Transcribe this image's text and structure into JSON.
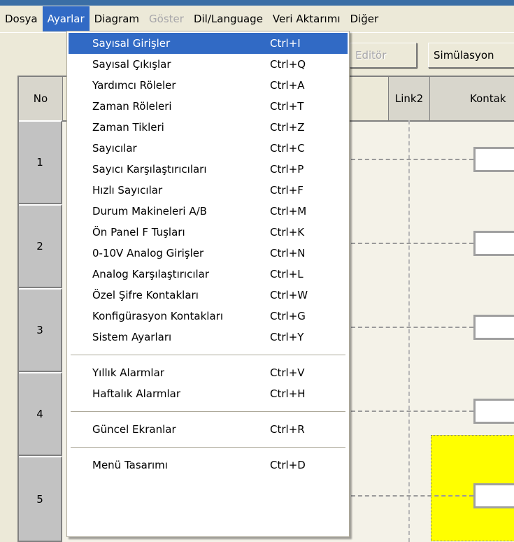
{
  "menubar": {
    "items": [
      {
        "label": "Dosya",
        "state": "normal"
      },
      {
        "label": "Ayarlar",
        "state": "active"
      },
      {
        "label": "Diagram",
        "state": "normal"
      },
      {
        "label": "Göster",
        "state": "disabled"
      },
      {
        "label": "Dil/Language",
        "state": "normal"
      },
      {
        "label": "Veri Aktarımı",
        "state": "normal"
      },
      {
        "label": "Diğer",
        "state": "normal"
      }
    ]
  },
  "toolbar": {
    "editor_label": "Editör",
    "simulation_label": "Simülasyon"
  },
  "grid": {
    "headers": {
      "no": "No",
      "link2": "Link2",
      "kontak": "Kontak"
    },
    "rows": [
      "1",
      "2",
      "3",
      "4",
      "5"
    ]
  },
  "dropdown": {
    "groups": [
      [
        {
          "label": "Sayısal Girişler",
          "shortcut": "Ctrl+I",
          "highlighted": true
        },
        {
          "label": "Sayısal Çıkışlar",
          "shortcut": "Ctrl+Q"
        },
        {
          "label": "Yardımcı Röleler",
          "shortcut": "Ctrl+A"
        },
        {
          "label": "Zaman Röleleri",
          "shortcut": "Ctrl+T"
        },
        {
          "label": "Zaman Tikleri",
          "shortcut": "Ctrl+Z"
        },
        {
          "label": "Sayıcılar",
          "shortcut": "Ctrl+C"
        },
        {
          "label": "Sayıcı Karşılaştırıcıları",
          "shortcut": "Ctrl+P"
        },
        {
          "label": "Hızlı Sayıcılar",
          "shortcut": "Ctrl+F"
        },
        {
          "label": "Durum Makineleri A/B",
          "shortcut": "Ctrl+M"
        },
        {
          "label": "Ön Panel F Tuşları",
          "shortcut": "Ctrl+K"
        },
        {
          "label": "0-10V Analog Girişler",
          "shortcut": "Ctrl+N"
        },
        {
          "label": "Analog Karşılaştırıcılar",
          "shortcut": "Ctrl+L"
        },
        {
          "label": "Özel Şifre Kontakları",
          "shortcut": "Ctrl+W"
        },
        {
          "label": "Konfigürasyon Kontakları",
          "shortcut": "Ctrl+G"
        },
        {
          "label": "Sistem Ayarları",
          "shortcut": "Ctrl+Y"
        }
      ],
      [
        {
          "label": "Yıllık Alarmlar",
          "shortcut": "Ctrl+V"
        },
        {
          "label": "Haftalık Alarmlar",
          "shortcut": "Ctrl+H"
        }
      ],
      [
        {
          "label": "Güncel Ekranlar",
          "shortcut": "Ctrl+R"
        }
      ],
      [
        {
          "label": "Menü Tasarımı",
          "shortcut": "Ctrl+D"
        }
      ]
    ]
  },
  "colors": {
    "highlight": "#316AC5",
    "face": "#ECE9D8",
    "yellow_block": "#FFFF00"
  }
}
